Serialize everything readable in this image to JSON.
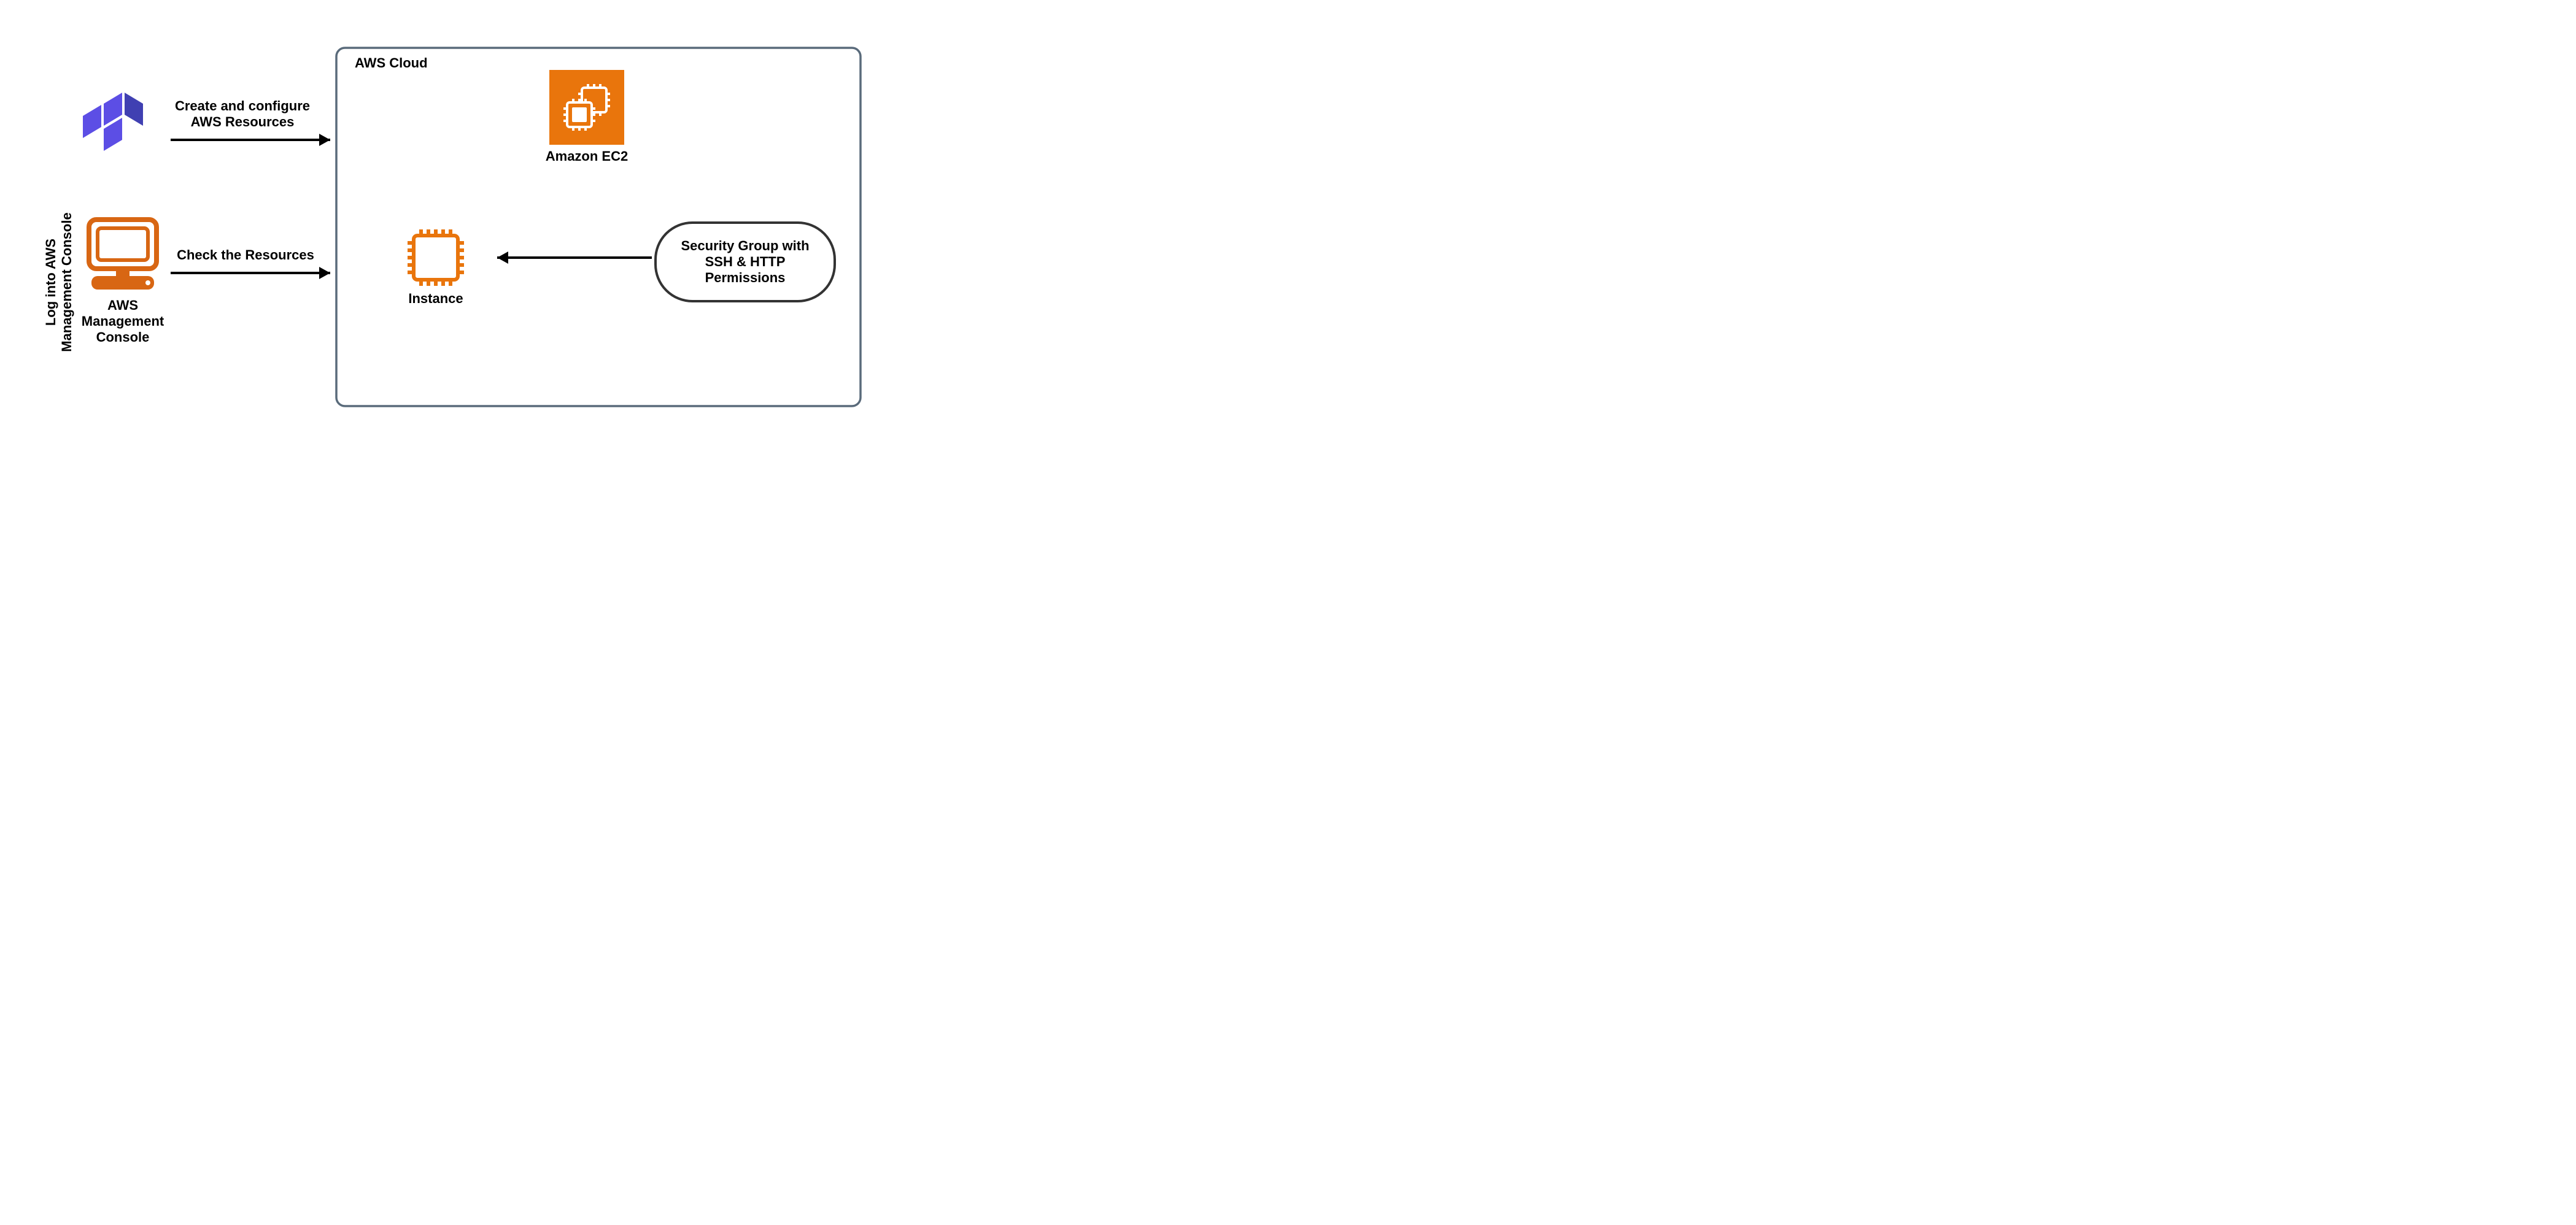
{
  "vertical_label": {
    "line1": "Log into AWS",
    "line2": "Management Console"
  },
  "terraform_arrow": {
    "line1": "Create and configure",
    "line2": "AWS Resources"
  },
  "console_arrow_label": "Check the Resources",
  "console_label": {
    "line1": "AWS",
    "line2": "Management",
    "line3": "Console"
  },
  "cloud_title": "AWS Cloud",
  "ec2_label": "Amazon EC2",
  "instance_label": "Instance",
  "security_group": {
    "line1": "Security Group with",
    "line2": "SSH & HTTP",
    "line3": "Permissions"
  }
}
